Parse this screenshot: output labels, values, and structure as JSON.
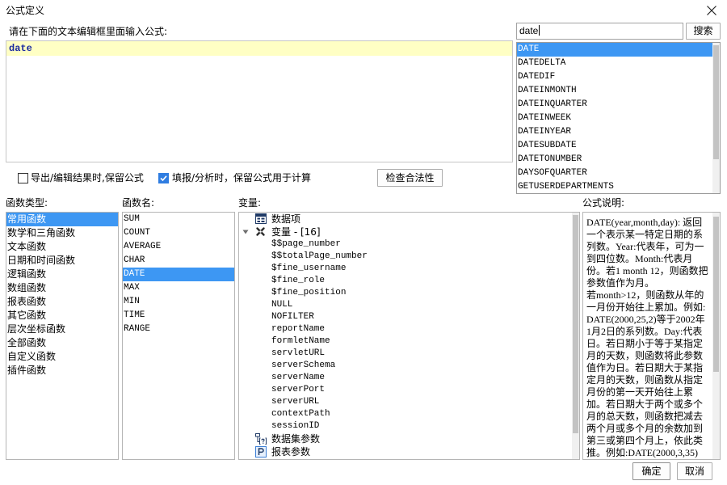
{
  "window": {
    "title": "公式定义",
    "close_icon": "close-icon"
  },
  "editor": {
    "prompt": "请在下面的文本编辑框里面输入公式:",
    "lines": [
      "date"
    ],
    "current_line": 0
  },
  "search": {
    "value": "date",
    "button_label": "搜索"
  },
  "suggestions": {
    "selected_index": 0,
    "items": [
      "DATE",
      "DATEDELTA",
      "DATEDIF",
      "DATEINMONTH",
      "DATEINQUARTER",
      "DATEINWEEK",
      "DATEINYEAR",
      "DATESUBDATE",
      "DATETONUMBER",
      "DAYSOFQUARTER",
      "GETUSERDEPARTMENTS"
    ]
  },
  "options": {
    "keep_formula_on_export": {
      "label": "导出/编辑结果时,保留公式",
      "checked": false
    },
    "keep_formula_on_fill": {
      "label": "填报/分析时，保留公式用于计算",
      "checked": true
    },
    "check_button_label": "检查合法性"
  },
  "function_types": {
    "label": "函数类型:",
    "selected_index": 0,
    "items": [
      "常用函数",
      "数学和三角函数",
      "文本函数",
      "日期和时间函数",
      "逻辑函数",
      "数组函数",
      "报表函数",
      "其它函数",
      "层次坐标函数",
      "全部函数",
      "自定义函数",
      "插件函数"
    ]
  },
  "function_names": {
    "label": "函数名:",
    "selected_index": 4,
    "items": [
      "SUM",
      "COUNT",
      "AVERAGE",
      "CHAR",
      "DATE",
      "MAX",
      "MIN",
      "TIME",
      "RANGE"
    ]
  },
  "variables": {
    "label": "变量:",
    "nodes": [
      {
        "label": "数据项",
        "icon": "data-item-icon",
        "expanded": false,
        "children": []
      },
      {
        "label": "变量 - [16]",
        "icon": "variable-icon",
        "expanded": true,
        "children": [
          "$$page_number",
          "$$totalPage_number",
          "$fine_username",
          "$fine_role",
          "$fine_position",
          "NULL",
          "NOFILTER",
          "reportName",
          "formletName",
          "servletURL",
          "serverSchema",
          "serverName",
          "serverPort",
          "serverURL",
          "contextPath",
          "sessionID"
        ]
      },
      {
        "label": "数据集参数",
        "icon": "dataset-parameter-icon",
        "expanded": false,
        "children": []
      },
      {
        "label": "报表参数",
        "icon": "report-parameter-icon",
        "expanded": false,
        "children": []
      }
    ]
  },
  "description": {
    "label": "公式说明:",
    "paragraphs": [
      "DATE(year,month,day): 返回一个表示某一特定日期的系列数。Year:代表年，可为一到四位数。Month:代表月份。若1 month 12，则函数把参数值作为月。",
      "若month>12，则函数从年的一月份开始往上累加。例如:DATE(2000,25,2)等于2002年1月2日的系列数。Day:代表日。若日期小于等于某指定月的天数，则函数将此参数值作为日。若日期大于某指定月的天数，则函数从指定月份的第一天开始往上累加。若日期大于两个或多个月的总天数，则函数把减去两个月或多个月的余数加到第三或第四个月上，依此类推。例如:DATE(2000,3,35)"
    ]
  },
  "footer": {
    "ok_label": "确定",
    "cancel_label": "取消"
  },
  "colors": {
    "selection": "#3d97f3",
    "selection_text": "#ffffff",
    "current_line_highlight": "#ffffc4",
    "formula_text": "#1a2aa0",
    "checkbox_checked": "#2f7de1"
  }
}
